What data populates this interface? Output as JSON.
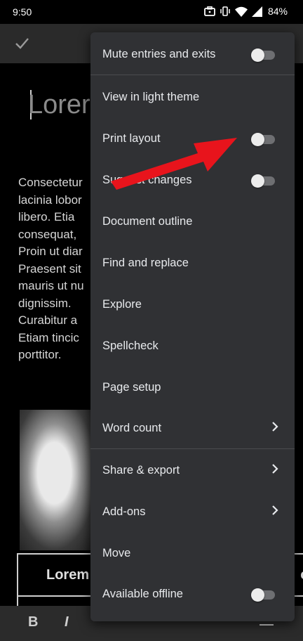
{
  "status": {
    "time": "9:50",
    "battery": "84%"
  },
  "document": {
    "title_visible": "Lorer",
    "paragraph_lines": [
      "Consectetur",
      "lacinia lobor",
      "libero.  Etia",
      "consequat,",
      "Proin ut diar",
      "Praesent sit",
      "mauris ut nu",
      "dignissim.",
      "Curabitur a",
      "Etiam  tincic",
      "porttitor."
    ],
    "table_header_left": "Lorem",
    "table_header_right": "ol"
  },
  "format_bar": {
    "bold": "B",
    "italic": "I"
  },
  "menu": {
    "items": [
      {
        "label": "Mute entries and exits",
        "control": "toggle",
        "checked": false
      },
      {
        "label": "View in light theme",
        "control": "none"
      },
      {
        "label": "Print layout",
        "control": "toggle",
        "checked": false
      },
      {
        "label": "Suggest changes",
        "control": "toggle",
        "checked": false
      },
      {
        "label": "Document outline",
        "control": "none"
      },
      {
        "label": "Find and replace",
        "control": "none"
      },
      {
        "label": "Explore",
        "control": "none"
      },
      {
        "label": "Spellcheck",
        "control": "none"
      },
      {
        "label": "Page setup",
        "control": "none"
      },
      {
        "label": "Word count",
        "control": "chevron"
      },
      {
        "label": "Share & export",
        "control": "chevron"
      },
      {
        "label": "Add-ons",
        "control": "chevron"
      },
      {
        "label": "Move",
        "control": "none"
      },
      {
        "label": "Available offline",
        "control": "toggle",
        "checked": false
      }
    ]
  },
  "colors": {
    "menu_bg": "#303134",
    "annotation_arrow": "#e8141c",
    "toggle_thumb": "#ececec"
  }
}
